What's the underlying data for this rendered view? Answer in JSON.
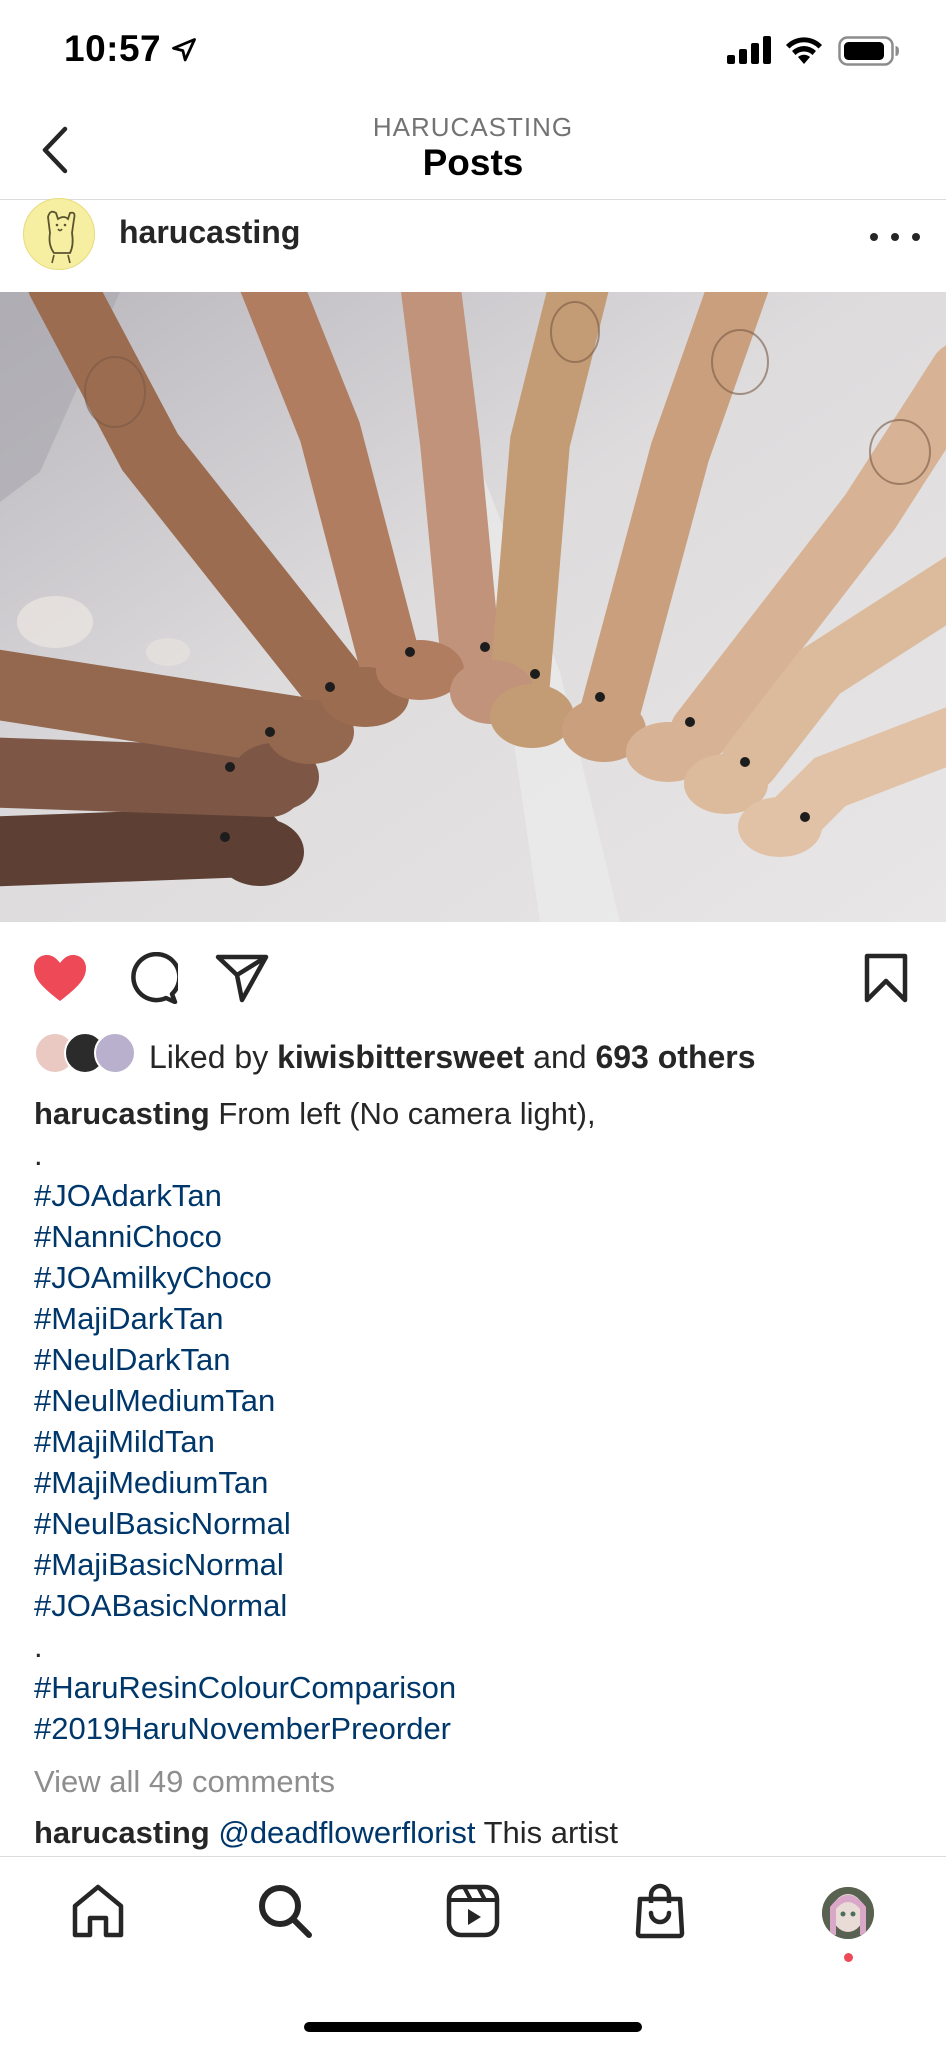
{
  "status_bar": {
    "time": "10:57",
    "icons": [
      "location-arrow-icon",
      "cellular-signal-icon",
      "wifi-icon",
      "battery-icon"
    ]
  },
  "header": {
    "subtitle": "HARUCASTING",
    "title": "Posts",
    "back_icon": "chevron-left-icon"
  },
  "post": {
    "author": "harucasting",
    "more_icon": "more-horizontal-icon",
    "image_icon": "doll-legs-photo",
    "actions": {
      "like_icon": "heart-filled-icon",
      "comment_icon": "comment-icon",
      "share_icon": "send-icon",
      "save_icon": "bookmark-icon",
      "liked": true
    },
    "likes": {
      "prefix": "Liked by ",
      "user": "kiwisbittersweet",
      "middle": " and ",
      "others": "693 others"
    },
    "caption": {
      "username": "harucasting",
      "text": " From left (No camera light),",
      "separator_1": ".",
      "tags_1": [
        "#JOAdarkTan",
        "#NanniChoco",
        "#JOAmilkyChoco",
        "#MajiDarkTan",
        "#NeulDarkTan",
        "#NeulMediumTan",
        "#MajiMildTan",
        "#MajiMediumTan",
        "#NeulBasicNormal",
        "#MajiBasicNormal",
        "#JOABasicNormal"
      ],
      "separator_2": ".",
      "tags_2": [
        "#HaruResinColourComparison",
        "#2019HaruNovemberPreorder"
      ]
    },
    "view_comments": "View all 49 comments",
    "comment": {
      "username": "harucasting",
      "mention": "@deadflowerflorist",
      "text": "  This artist"
    }
  },
  "tab_bar": {
    "tabs": [
      "home-icon",
      "search-icon",
      "reels-icon",
      "shop-icon",
      "profile-avatar"
    ]
  },
  "colors": {
    "like_red": "#ed4956",
    "hashtag_blue": "#00376b",
    "muted_gray": "#8e8e8e",
    "avatar_yellow": "#f6eea0"
  }
}
